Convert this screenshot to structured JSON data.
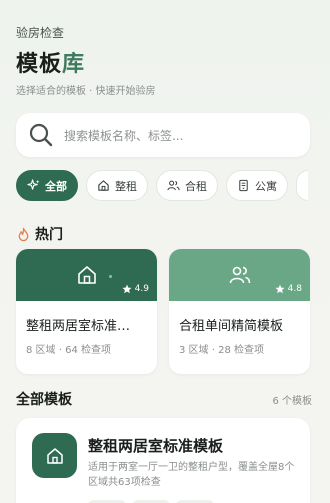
{
  "header": {
    "top_label": "验房检查",
    "title_main": "模板",
    "title_accent": "库",
    "subtitle": "选择适合的模板 · 快速开始验房"
  },
  "search": {
    "placeholder": "搜索模板名称、标签..."
  },
  "filters": [
    {
      "label": "全部",
      "icon": "sparkle-icon",
      "active": true
    },
    {
      "label": "整租",
      "icon": "home-icon",
      "active": false
    },
    {
      "label": "合租",
      "icon": "users-icon",
      "active": false
    },
    {
      "label": "公寓",
      "icon": "apartment-icon",
      "active": false
    }
  ],
  "hot": {
    "title": "热门",
    "cards": [
      {
        "name": "整租两居室标准…",
        "meta": "8 区域 · 64 检查项",
        "rating": "4.9",
        "icon": "home-icon",
        "color": "#2f6b52"
      },
      {
        "name": "合租单间精简模板",
        "meta": "3 区域 · 28 检查项",
        "rating": "4.8",
        "icon": "users-icon",
        "color": "#6aa787"
      }
    ]
  },
  "all": {
    "title": "全部模板",
    "count": "6 个模板",
    "items": [
      {
        "name": "整租两居室标准模板",
        "desc": "适用于两室一厅一卫的整租户型，覆盖全屋8个区域共63项检查",
        "icon": "home-icon"
      }
    ]
  },
  "colors": {
    "primary": "#2f6b52",
    "secondary": "#6aa787",
    "accent_flame": "#e0824a"
  }
}
